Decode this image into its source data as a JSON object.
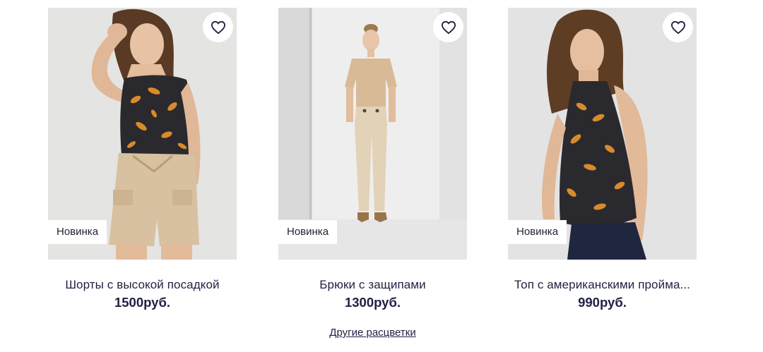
{
  "products": [
    {
      "name": "Шорты с высокой посадкой",
      "price": "1500руб.",
      "badge": "Новинка",
      "favorite_icon": "heart-outline-icon",
      "image": "woman-printed-top-beige-shorts"
    },
    {
      "name": "Брюки с защипами",
      "price": "1300руб.",
      "badge": "Новинка",
      "favorite_icon": "heart-outline-icon",
      "image": "woman-beige-tee-beige-trousers",
      "other_colors_link": "Другие расцветки"
    },
    {
      "name": "Топ с американскими пройма...",
      "price": "990руб.",
      "badge": "Новинка",
      "favorite_icon": "heart-outline-icon",
      "image": "woman-printed-halter-top-jeans"
    }
  ],
  "colors": {
    "text": "#1f2142",
    "badge_bg": "#ffffff",
    "favorite_bg": "#ffffff",
    "print_dark": "#2a2a2e",
    "print_orange": "#d98a2b",
    "beige": "#d9c3a3"
  }
}
